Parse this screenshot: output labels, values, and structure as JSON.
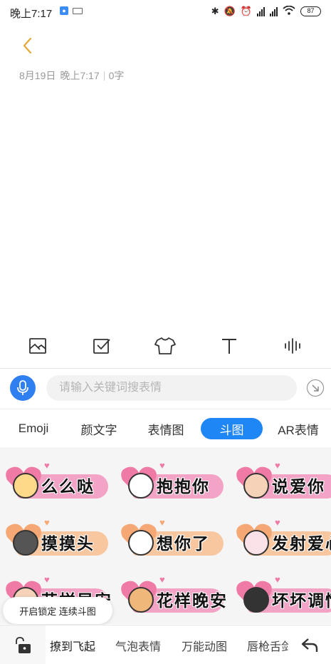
{
  "status_bar": {
    "time": "晚上7:17",
    "battery": "87"
  },
  "note": {
    "date": "8月19日",
    "time": "晚上7:17",
    "word_count": "0字"
  },
  "toolbar": {
    "icons": [
      "image-icon",
      "checklist-icon",
      "theme-shirt-icon",
      "text-format-icon",
      "voice-wave-icon"
    ]
  },
  "search": {
    "placeholder": "请输入关键词搜表情"
  },
  "tabs": [
    {
      "label": "Emoji",
      "active": false
    },
    {
      "label": "颜文字",
      "active": false
    },
    {
      "label": "表情图",
      "active": false
    },
    {
      "label": "斗图",
      "active": true
    },
    {
      "label": "AR表情",
      "active": false
    }
  ],
  "stickers": [
    {
      "text": "么么哒"
    },
    {
      "text": "抱抱你"
    },
    {
      "text": "说爱你"
    },
    {
      "text": "摸摸头"
    },
    {
      "text": "想你了"
    },
    {
      "text": "发射爱心"
    },
    {
      "text": "花样早安"
    },
    {
      "text": "花样晚安"
    },
    {
      "text": "坏坏调情"
    }
  ],
  "lock_tooltip": "开启锁定 连续斗图",
  "bottom_categories": [
    {
      "label": "撩到飞起"
    },
    {
      "label": "气泡表情"
    },
    {
      "label": "万能动图"
    },
    {
      "label": "唇枪舌剑"
    }
  ],
  "colors": {
    "accent": "#1e86f5",
    "back_arrow": "#e5a93a",
    "band_pink": "#f3a4c6",
    "band_peach": "#f8c7a0",
    "heart_pink": "#f07aa6"
  }
}
